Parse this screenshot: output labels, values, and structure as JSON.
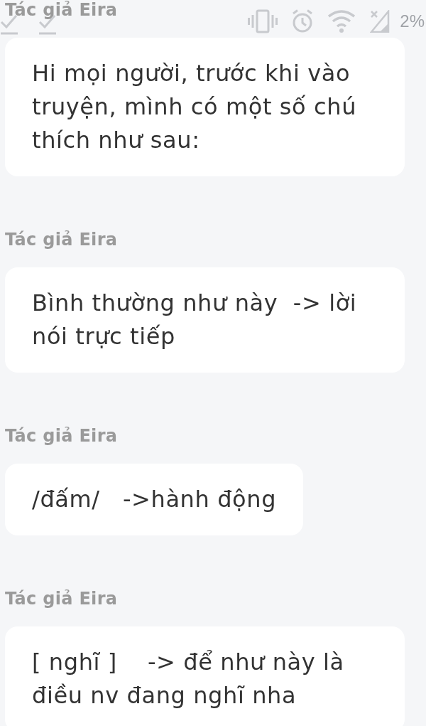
{
  "status_bar": {
    "battery_text": "2%"
  },
  "messages": [
    {
      "author": "Tác giả Eira",
      "text": "Hi mọi người, trước khi vào truyện, mình có một số chú thích như sau:"
    },
    {
      "author": "Tác giả Eira",
      "text": "Bình thường như này  -> lời nói trực tiếp"
    },
    {
      "author": "Tác giả Eira",
      "text": "/đấm/   ->hành động"
    },
    {
      "author": "Tác giả Eira",
      "text": "[ nghĩ ]    -> để như này là điều nv đang nghĩ nha"
    }
  ]
}
